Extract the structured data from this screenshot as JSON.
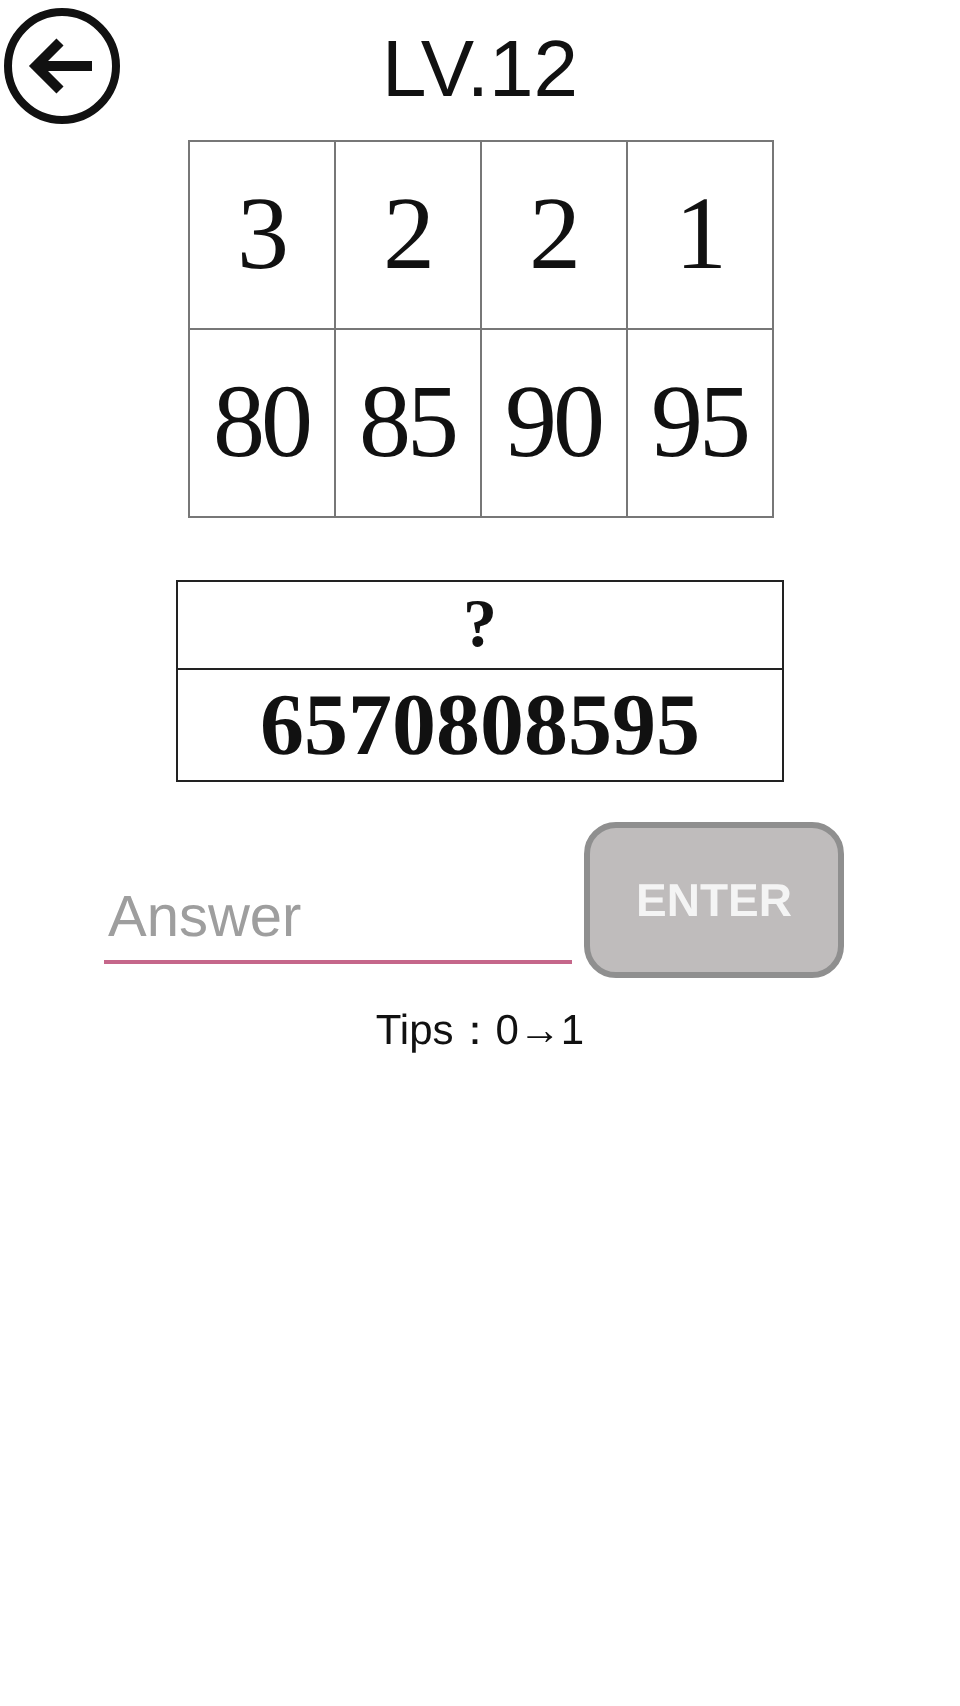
{
  "header": {
    "title": "LV.12"
  },
  "puzzle_grid": {
    "rows": [
      [
        "3",
        "2",
        "2",
        "1"
      ],
      [
        "80",
        "85",
        "90",
        "95"
      ]
    ]
  },
  "clue_table": {
    "rows": [
      "?",
      "6570808595"
    ]
  },
  "answer": {
    "placeholder": "Answer"
  },
  "enter_button": {
    "label": "ENTER"
  },
  "tips": "Tips：0→1"
}
